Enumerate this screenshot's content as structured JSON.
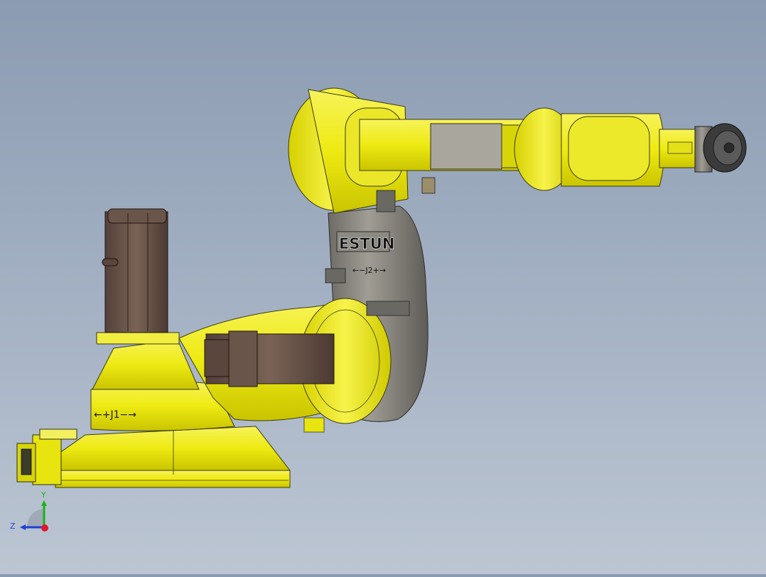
{
  "model": {
    "brand_label": "ESTUN",
    "joint1_label": "←+J1−→",
    "joint2_label": "←−J2+→",
    "body_color": "#f2ee16",
    "motor_color": "#6b5448",
    "casting_color": "#8f8c84"
  },
  "triad": {
    "y_label": "Y",
    "z_label": "Z",
    "y_axis_color": "#19b219",
    "z_axis_color": "#1f3fd6",
    "x_axis_color": "#e0182a"
  }
}
